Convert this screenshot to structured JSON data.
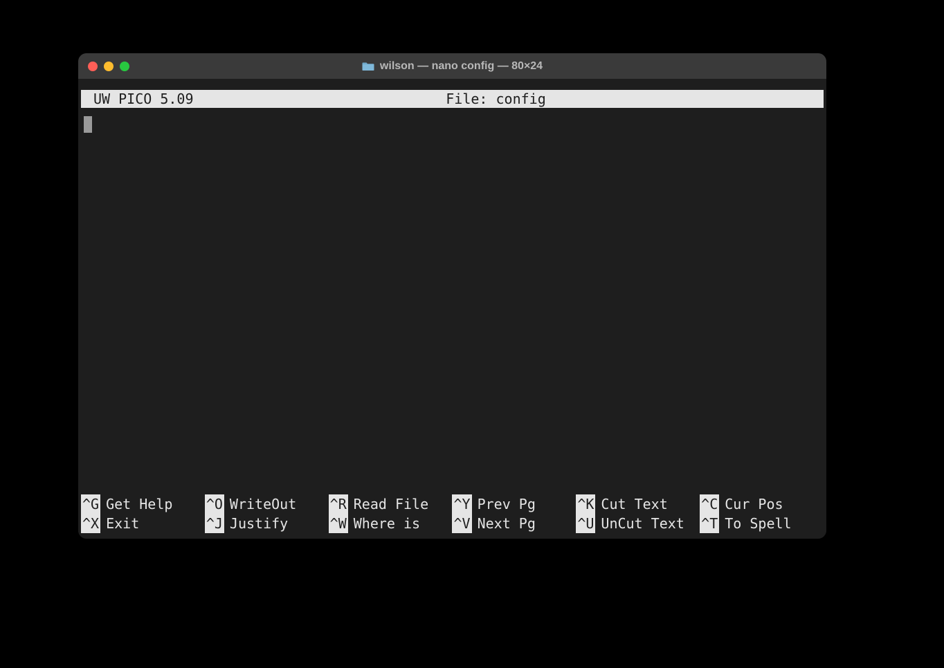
{
  "window": {
    "title": "wilson — nano config — 80×24"
  },
  "pico": {
    "app_label": "UW PICO 5.09",
    "file_label": "File: config"
  },
  "shortcuts": {
    "row1": [
      {
        "key": "^G",
        "label": "Get Help"
      },
      {
        "key": "^O",
        "label": "WriteOut"
      },
      {
        "key": "^R",
        "label": "Read File"
      },
      {
        "key": "^Y",
        "label": "Prev Pg"
      },
      {
        "key": "^K",
        "label": "Cut Text"
      },
      {
        "key": "^C",
        "label": "Cur Pos"
      }
    ],
    "row2": [
      {
        "key": "^X",
        "label": "Exit"
      },
      {
        "key": "^J",
        "label": "Justify"
      },
      {
        "key": "^W",
        "label": "Where is"
      },
      {
        "key": "^V",
        "label": "Next Pg"
      },
      {
        "key": "^U",
        "label": "UnCut Text"
      },
      {
        "key": "^T",
        "label": "To Spell"
      }
    ]
  }
}
